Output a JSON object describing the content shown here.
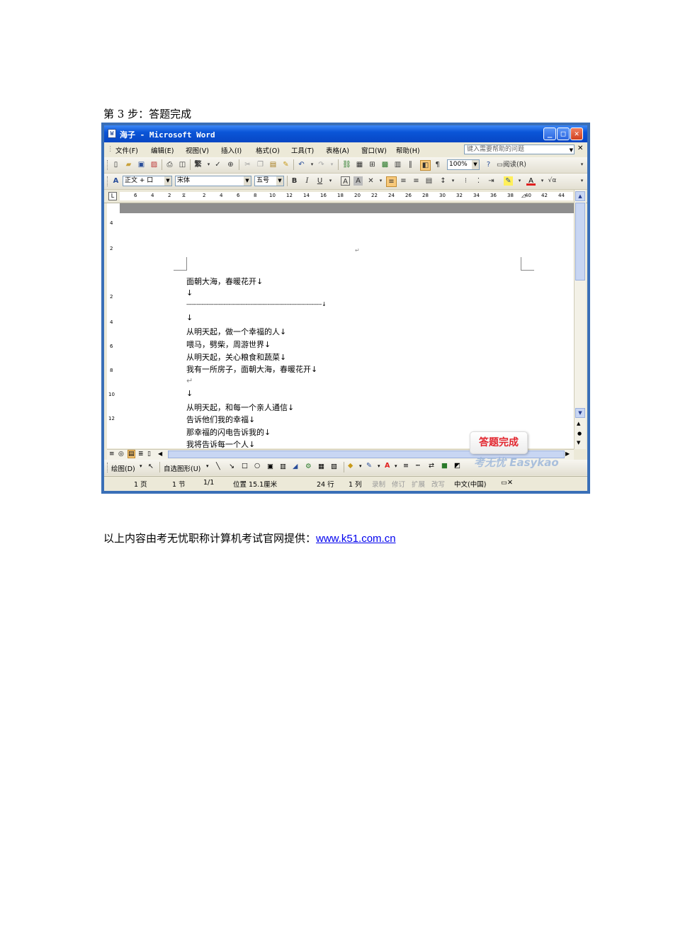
{
  "heading": "第 3 步：答题完成",
  "footer": {
    "text": "以上内容由考无忧职称计算机考试官网提供：",
    "link": "www.k51.com.cn "
  },
  "window": {
    "title": "海子 - Microsoft Word",
    "menu": [
      "文件(F)",
      "编辑(E)",
      "视图(V)",
      "插入(I)",
      "格式(O)",
      "工具(T)",
      "表格(A)",
      "窗口(W)",
      "帮助(H)"
    ],
    "help_placeholder": "键入需要帮助的问题",
    "zoom": "100%",
    "read_button": "阅读(R)",
    "style_value": "正文 + 口",
    "font_value": "宋体",
    "size_value": "五号",
    "ruler_ticks": [
      "6",
      "4",
      "2",
      "2",
      "4",
      "6",
      "8",
      "10",
      "12",
      "14",
      "16",
      "18",
      "20",
      "22",
      "24",
      "26",
      "28",
      "30",
      "32",
      "34",
      "36",
      "38",
      "40",
      "42",
      "44"
    ],
    "vruler_ticks": [
      "4",
      "2",
      "2",
      "4",
      "6",
      "8",
      "10",
      "12"
    ],
    "doc_lines": [
      "面朝大海，春暖花开↓",
      "↓",
      "--------------------------------------------------------------------------------↓",
      "↓",
      "从明天起，做一个幸福的人↓",
      "喂马，劈柴，周游世界↓",
      "从明天起，关心粮食和蔬菜↓",
      "我有一所房子，面朝大海，春暖花开↓",
      "↵",
      "↓",
      "从明天起，和每一个亲人通信↓",
      "告诉他们我的幸福↓",
      "那幸福的闪电告诉我的↓",
      "我将告诉每一个人↓"
    ],
    "draw_label": "绘图(D)",
    "autoshape_label": "自选图形(U)",
    "status": {
      "page": "1 页",
      "section": "1 节",
      "pages": "1/1",
      "position": "位置 15.1厘米",
      "line": "24 行",
      "col": "1 列",
      "rec": "录制",
      "trk": "修订",
      "ext": "扩展",
      "ovr": "改写",
      "lang": "中文(中国)"
    },
    "badge": "答题完成",
    "watermark": "考无忧 Easykao"
  }
}
